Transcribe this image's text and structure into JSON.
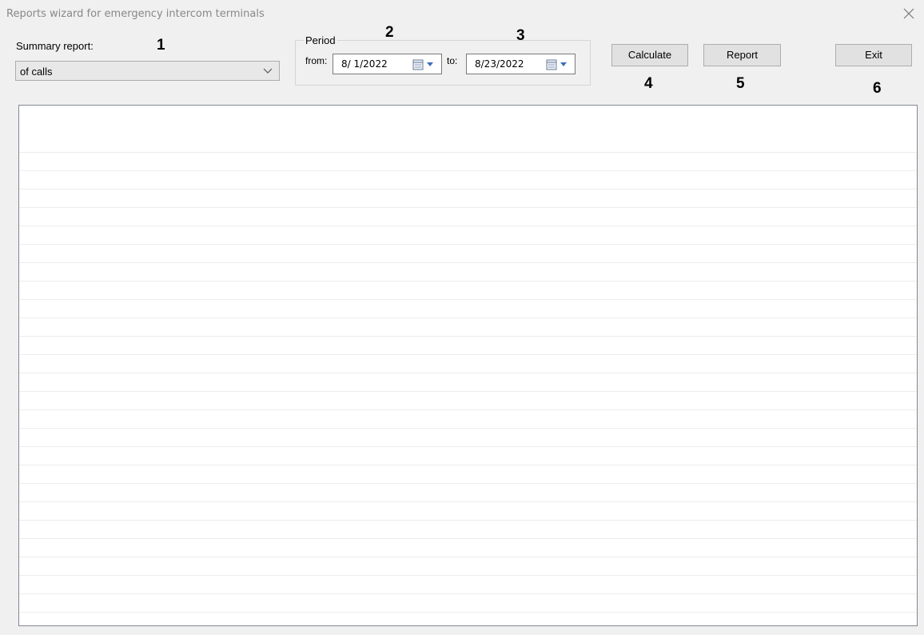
{
  "window": {
    "title": "Reports wizard for emergency intercom terminals",
    "close_icon": "close-icon"
  },
  "summary": {
    "label": "Summary report:",
    "value": "of calls",
    "arrow_icon": "chevron-down-icon"
  },
  "period": {
    "legend": "Period",
    "from_label": "from:",
    "from_value": "8/ 1/2022",
    "to_label": "to:",
    "to_value": "8/23/2022",
    "calendar_icon": "calendar-icon"
  },
  "buttons": {
    "calculate": "Calculate",
    "report": "Report",
    "exit": "Exit"
  },
  "markers": [
    "1",
    "2",
    "3",
    "4",
    "5",
    "6"
  ],
  "colors": {
    "background": "#f0f0f0",
    "list_background": "#ffffff",
    "title_text": "#888888",
    "row_line": "#ececec"
  }
}
